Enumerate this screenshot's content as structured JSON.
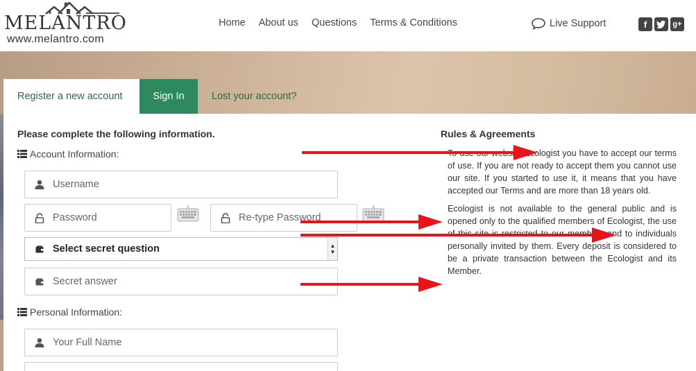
{
  "brand": {
    "name": "MELANTRO",
    "url": "www.melantro.com"
  },
  "nav": {
    "items": [
      "Home",
      "About us",
      "Questions",
      "Terms & Conditions"
    ]
  },
  "support": {
    "label": "Live Support"
  },
  "social": {
    "items": [
      "facebook-icon",
      "twitter-icon",
      "google-plus-icon"
    ]
  },
  "tabs": {
    "register": "Register a new account",
    "signin": "Sign In",
    "lost": "Lost your account?"
  },
  "form": {
    "title": "Please complete the following information.",
    "account_section": "Account Information:",
    "username_placeholder": "Username",
    "password_placeholder": "Password",
    "retype_placeholder": "Re-type Password",
    "secret_question": "Select secret question",
    "secret_answer_placeholder": "Secret answer",
    "personal_section": "Personal Information:",
    "fullname_placeholder": "Your Full Name"
  },
  "rules": {
    "title": "Rules & Agreements",
    "p1": "To use our website Ecologist you have to accept our terms of use. If you are not ready to accept them you cannot use our site. If you started to use it, it means that you have accepted our Terms and are more than 18 years old.",
    "p2": "Ecologist is not available to the general public and is opened only to the qualified members of Ecologist, the use of this site is restricted to our members and to individuals personally invited by them. Every deposit is considered to be a private transaction between the Ecologist and its Member."
  },
  "colors": {
    "accent": "#2d8a5e",
    "accent_text": "#2a6b49",
    "arrow": "#e8141a"
  }
}
